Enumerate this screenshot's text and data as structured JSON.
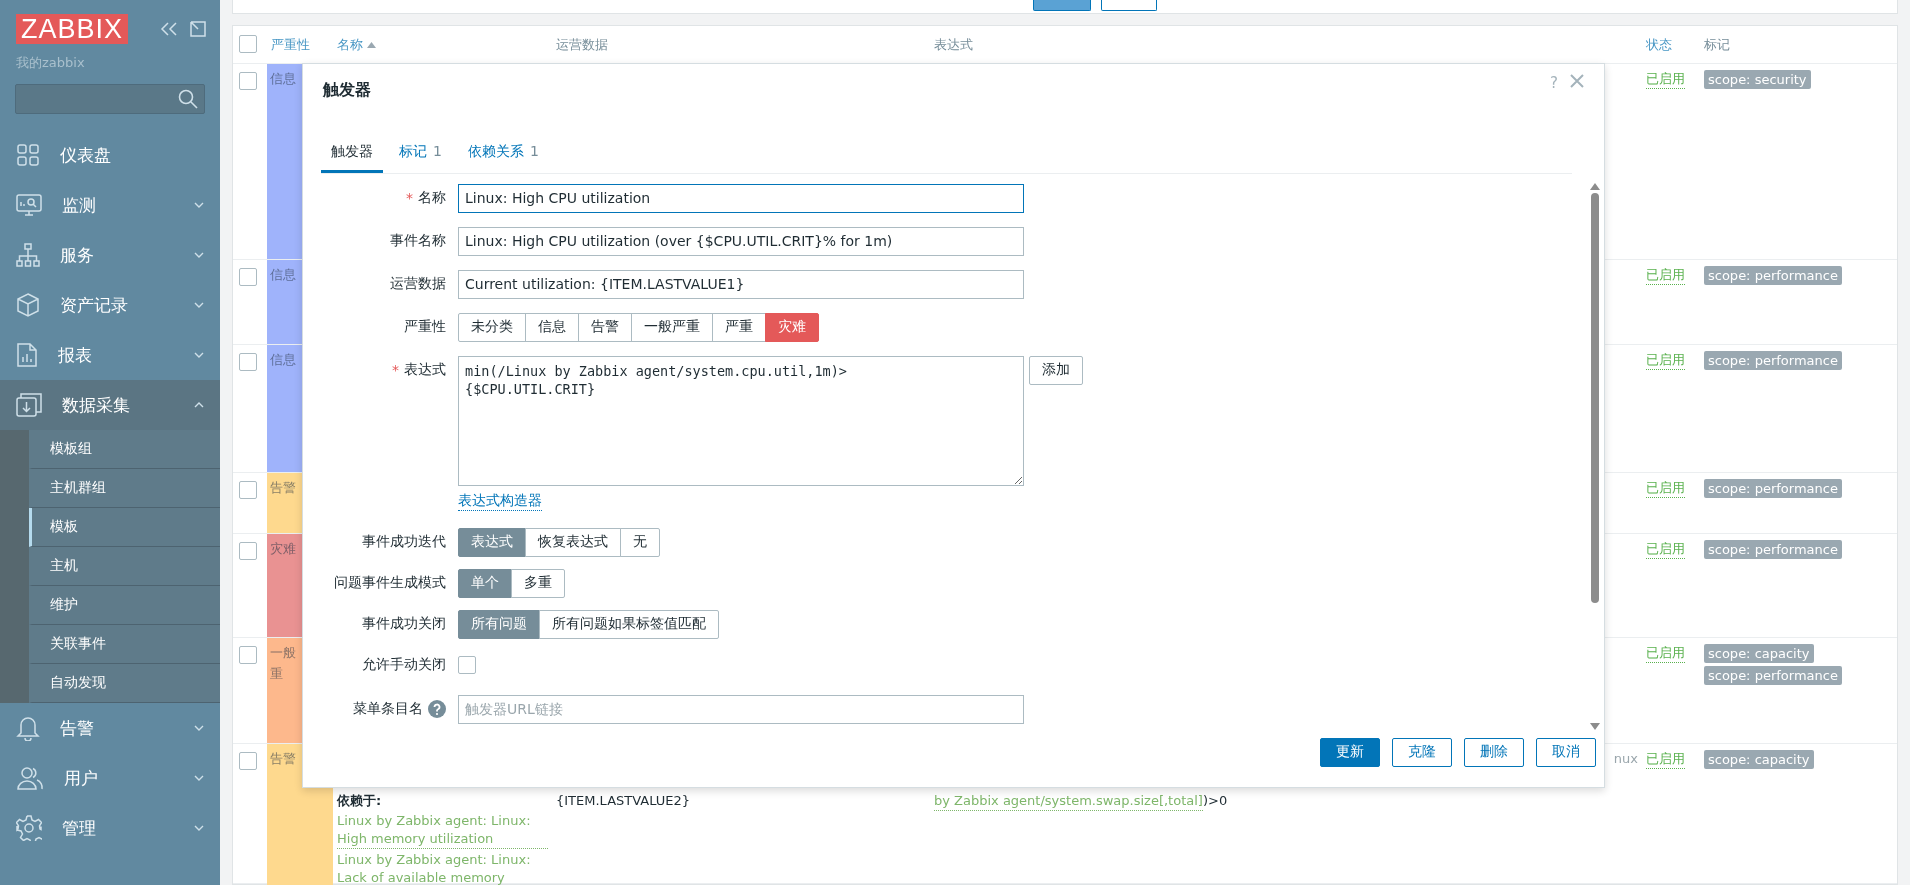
{
  "sidebar": {
    "logo": "ZABBIX",
    "subtitle": "我的zabbix",
    "menu": [
      {
        "label": "仪表盘",
        "kind": "link"
      },
      {
        "label": "监测",
        "kind": "group",
        "expanded": false
      },
      {
        "label": "服务",
        "kind": "group",
        "expanded": false
      },
      {
        "label": "资产记录",
        "kind": "group",
        "expanded": false
      },
      {
        "label": "报表",
        "kind": "group",
        "expanded": false
      },
      {
        "label": "数据采集",
        "kind": "group",
        "expanded": true,
        "children": [
          {
            "label": "模板组",
            "selected": false
          },
          {
            "label": "主机群组",
            "selected": false
          },
          {
            "label": "模板",
            "selected": true
          },
          {
            "label": "主机",
            "selected": false
          },
          {
            "label": "维护",
            "selected": false
          },
          {
            "label": "关联事件",
            "selected": false
          },
          {
            "label": "自动发现",
            "selected": false
          }
        ]
      },
      {
        "label": "告警",
        "kind": "group",
        "expanded": false
      },
      {
        "label": "用户",
        "kind": "group",
        "expanded": false
      },
      {
        "label": "管理",
        "kind": "group",
        "expanded": false
      }
    ]
  },
  "table": {
    "select_all_checked": false,
    "columns": [
      {
        "label": "严重性",
        "link": true
      },
      {
        "label": "名称",
        "link": true,
        "sorted": true
      },
      {
        "label": "运营数据",
        "link": false
      },
      {
        "label": "表达式",
        "link": false
      },
      {
        "label": "状态",
        "link": true
      },
      {
        "label": "标记",
        "link": false
      }
    ],
    "rows": [
      {
        "checked": false,
        "severity": [
          "信息"
        ],
        "color": "#9fb3fb",
        "status": "已启用",
        "tags": [
          "scope: security"
        ]
      },
      {
        "checked": false,
        "severity": [
          "信息"
        ],
        "color": "#9fb3fb",
        "status": "已启用",
        "tags": [
          "scope: performance"
        ]
      },
      {
        "checked": false,
        "severity": [
          "信息"
        ],
        "color": "#9fb3fb",
        "status": "已启用",
        "tags": [
          "scope: performance"
        ]
      },
      {
        "checked": false,
        "severity": [
          "告警"
        ],
        "color": "#fed98e",
        "status": "已启用",
        "tags": [
          "scope: performance"
        ]
      },
      {
        "checked": false,
        "severity": [
          "灾难"
        ],
        "color": "#e99292",
        "status": "已启用",
        "tags": [
          "scope: performance"
        ]
      },
      {
        "checked": false,
        "severity": [
          "一般",
          "重"
        ],
        "color": "#fdb88c",
        "status": "已启用",
        "tags": [
          "scope: capacity",
          "scope: performance"
        ]
      },
      {
        "checked": false,
        "severity": [
          "告警"
        ],
        "color": "#fed98e",
        "status": "已启用",
        "tags": [
          "scope: capacity"
        ],
        "depends_label": "依赖于:",
        "dependencies": [
          "Linux by Zabbix agent: Linux: High memory utilization",
          "Linux by Zabbix agent: Linux: Lack of available memory"
        ],
        "opdata": "{ITEM.LASTVALUE2}",
        "expression_head": "nux",
        "expression_link": "by Zabbix agent/system.swap.size[,total]",
        "expression_tail": ")>0"
      }
    ]
  },
  "dialog": {
    "title": "触发器",
    "help": "?",
    "tabs": [
      {
        "label": "触发器",
        "selected": true
      },
      {
        "label": "标记",
        "count": "1",
        "selected": false
      },
      {
        "label": "依赖关系",
        "count": "1",
        "selected": false
      }
    ],
    "fields": [
      {
        "kind": "text",
        "label": "名称",
        "required_mark": "*",
        "value": "Linux: High CPU utilization",
        "focused": true
      },
      {
        "kind": "text",
        "label": "事件名称",
        "value": "Linux: High CPU utilization (over {$CPU.UTIL.CRIT}% for 1m)",
        "focused": false
      },
      {
        "kind": "text",
        "label": "运营数据",
        "value": "Current utilization: {ITEM.LASTVALUE1}",
        "focused": false
      },
      {
        "kind": "severity",
        "label": "严重性",
        "options": [
          {
            "label": "未分类",
            "selected": false
          },
          {
            "label": "信息",
            "selected": false
          },
          {
            "label": "告警",
            "selected": false
          },
          {
            "label": "一般严重",
            "selected": false
          },
          {
            "label": "严重",
            "selected": false
          },
          {
            "label": "灾难",
            "selected": true
          }
        ]
      },
      {
        "kind": "textarea",
        "label": "表达式",
        "required_mark": "*",
        "value": "min(/Linux by Zabbix agent/system.cpu.util,1m)>\n{$CPU.UTIL.CRIT}",
        "button": "添加",
        "link": "表达式构造器"
      },
      {
        "kind": "segmented",
        "label": "事件成功迭代",
        "options": [
          {
            "label": "表达式",
            "selected": true
          },
          {
            "label": "恢复表达式",
            "selected": false
          },
          {
            "label": "无",
            "selected": false
          }
        ]
      },
      {
        "kind": "segmented",
        "label": "问题事件生成模式",
        "options": [
          {
            "label": "单个",
            "selected": true
          },
          {
            "label": "多重",
            "selected": false
          }
        ]
      },
      {
        "kind": "segmented",
        "label": "事件成功关闭",
        "options": [
          {
            "label": "所有问题",
            "selected": true
          },
          {
            "label": "所有问题如果标签值匹配",
            "selected": false
          }
        ]
      },
      {
        "kind": "checkbox",
        "label": "允许手动关闭",
        "checked": false
      },
      {
        "kind": "text",
        "label": "菜单条目名",
        "help": true,
        "placeholder": "触发器URL链接",
        "focused": false
      }
    ],
    "buttons": [
      {
        "label": "更新",
        "primary": true
      },
      {
        "label": "克隆",
        "primary": false
      },
      {
        "label": "删除",
        "primary": false
      },
      {
        "label": "取消",
        "primary": false
      }
    ]
  }
}
